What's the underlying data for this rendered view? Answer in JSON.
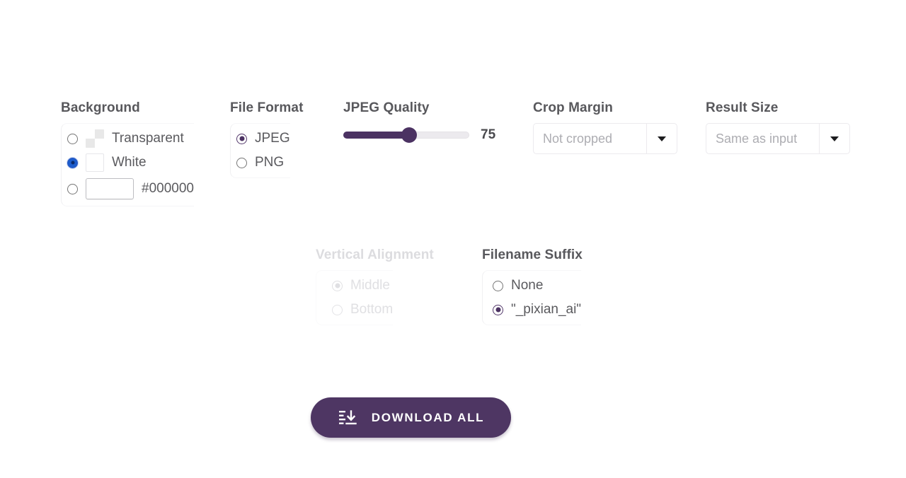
{
  "page": {
    "background_color": "#ffffff",
    "accent_color": "#4e3663",
    "heading_color": "#58585c",
    "label_color": "#5a5a5e",
    "disabled_color": "#e0e0e3"
  },
  "background_group": {
    "title": "Background",
    "options": [
      {
        "label": "Transparent",
        "selected": false,
        "swatch": "checkerboard-swatch"
      },
      {
        "label": "White",
        "selected": true,
        "swatch": "white-swatch"
      },
      {
        "label": "#000000",
        "selected": false,
        "swatch": "black-color-swatch",
        "color": "#000000"
      }
    ]
  },
  "file_format_group": {
    "title": "File Format",
    "options": [
      {
        "label": "JPEG",
        "selected": true
      },
      {
        "label": "PNG",
        "selected": false
      }
    ]
  },
  "jpeg_quality_group": {
    "title": "JPEG Quality",
    "value": 75,
    "value_text": "75",
    "min": 0,
    "max": 100,
    "percent": 52
  },
  "crop_margin_group": {
    "title": "Crop Margin",
    "selected_value": "Not cropped",
    "caret_icon": "chevron-down-icon"
  },
  "result_size_group": {
    "title": "Result Size",
    "selected_value": "Same as input",
    "caret_icon": "chevron-down-icon"
  },
  "vertical_alignment_group": {
    "title": "Vertical Alignment",
    "disabled": true,
    "options": [
      {
        "label": "Middle",
        "selected": true
      },
      {
        "label": "Bottom",
        "selected": false
      }
    ]
  },
  "filename_suffix_group": {
    "title": "Filename Suffix",
    "options": [
      {
        "label": "None",
        "selected": false
      },
      {
        "label": "\"_pixian_ai\"",
        "selected": true
      }
    ]
  },
  "download_button": {
    "label": "DOWNLOAD ALL",
    "icon": "download-list-icon",
    "background_color": "#4e3663",
    "text_color": "#ffffff"
  }
}
